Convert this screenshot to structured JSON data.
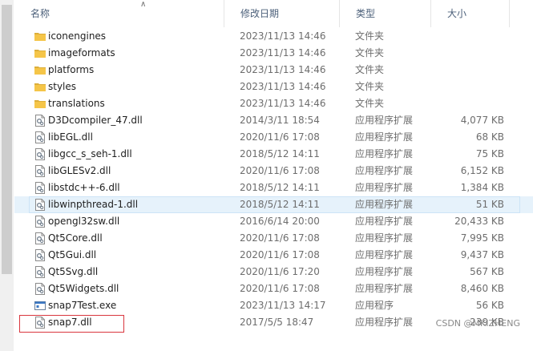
{
  "columns": {
    "name": "名称",
    "date": "修改日期",
    "type": "类型",
    "size": "大小"
  },
  "rows": [
    {
      "name": "iconengines",
      "date": "2023/11/13 14:46",
      "type": "文件夹",
      "size": "",
      "icon": "folder-icon"
    },
    {
      "name": "imageformats",
      "date": "2023/11/13 14:46",
      "type": "文件夹",
      "size": "",
      "icon": "folder-icon"
    },
    {
      "name": "platforms",
      "date": "2023/11/13 14:46",
      "type": "文件夹",
      "size": "",
      "icon": "folder-icon"
    },
    {
      "name": "styles",
      "date": "2023/11/13 14:46",
      "type": "文件夹",
      "size": "",
      "icon": "folder-icon"
    },
    {
      "name": "translations",
      "date": "2023/11/13 14:46",
      "type": "文件夹",
      "size": "",
      "icon": "folder-icon"
    },
    {
      "name": "D3Dcompiler_47.dll",
      "date": "2014/3/11 18:54",
      "type": "应用程序扩展",
      "size": "4,077 KB",
      "icon": "dll-icon"
    },
    {
      "name": "libEGL.dll",
      "date": "2020/11/6 17:08",
      "type": "应用程序扩展",
      "size": "68 KB",
      "icon": "dll-icon"
    },
    {
      "name": "libgcc_s_seh-1.dll",
      "date": "2018/5/12 14:11",
      "type": "应用程序扩展",
      "size": "75 KB",
      "icon": "dll-icon"
    },
    {
      "name": "libGLESv2.dll",
      "date": "2020/11/6 17:08",
      "type": "应用程序扩展",
      "size": "6,152 KB",
      "icon": "dll-icon"
    },
    {
      "name": "libstdc++-6.dll",
      "date": "2018/5/12 14:11",
      "type": "应用程序扩展",
      "size": "1,384 KB",
      "icon": "dll-icon"
    },
    {
      "name": "libwinpthread-1.dll",
      "date": "2018/5/12 14:11",
      "type": "应用程序扩展",
      "size": "51 KB",
      "icon": "dll-icon",
      "selected": true
    },
    {
      "name": "opengl32sw.dll",
      "date": "2016/6/14 20:00",
      "type": "应用程序扩展",
      "size": "20,433 KB",
      "icon": "dll-icon"
    },
    {
      "name": "Qt5Core.dll",
      "date": "2020/11/6 17:08",
      "type": "应用程序扩展",
      "size": "7,995 KB",
      "icon": "dll-icon"
    },
    {
      "name": "Qt5Gui.dll",
      "date": "2020/11/6 17:08",
      "type": "应用程序扩展",
      "size": "9,437 KB",
      "icon": "dll-icon"
    },
    {
      "name": "Qt5Svg.dll",
      "date": "2020/11/6 17:20",
      "type": "应用程序扩展",
      "size": "567 KB",
      "icon": "dll-icon"
    },
    {
      "name": "Qt5Widgets.dll",
      "date": "2020/11/6 17:08",
      "type": "应用程序扩展",
      "size": "8,460 KB",
      "icon": "dll-icon"
    },
    {
      "name": "snap7Test.exe",
      "date": "2023/11/13 14:17",
      "type": "应用程序",
      "size": "56 KB",
      "icon": "exe-icon"
    },
    {
      "name": "snap7.dll",
      "date": "2017/5/5 18:47",
      "type": "应用程序扩展",
      "size": "239 KB",
      "icon": "dll-icon"
    }
  ],
  "watermark": "CSDN @MKIZHENG",
  "colors": {
    "folder": "#f5c548",
    "selection": "#e6f2fb",
    "highlight_box": "#d9363e"
  }
}
